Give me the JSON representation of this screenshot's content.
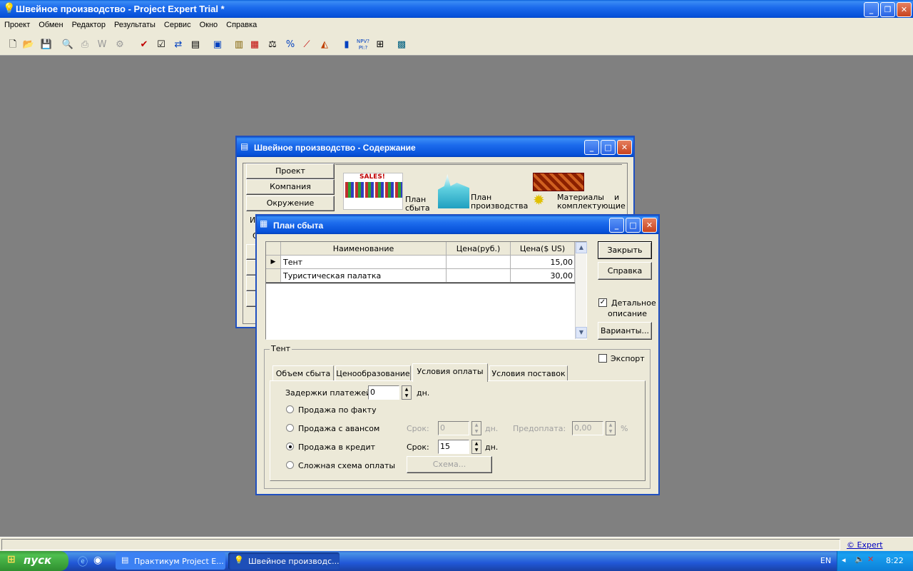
{
  "app": {
    "title": "Швейное производство - Project Expert Trial *",
    "menu": [
      "Проект",
      "Обмен",
      "Редактор",
      "Результаты",
      "Сервис",
      "Окно",
      "Справка"
    ]
  },
  "content_window": {
    "title": "Швейное производство - Содержание",
    "buttons": [
      "Проект",
      "Компания",
      "Окружение"
    ],
    "partial_labels": [
      "И",
      "О"
    ],
    "tiles": [
      {
        "icon": "sales-plan-icon",
        "label1": "План",
        "label2": "сбыта",
        "badge": "SALES!"
      },
      {
        "icon": "production-plan-icon",
        "label1": "План",
        "label2": "производства"
      },
      {
        "icon": "materials-icon",
        "label1": "Материалы    и",
        "label2": "комплектующие"
      }
    ]
  },
  "sales_dialog": {
    "title": "План сбыта",
    "columns": [
      "Наименование",
      "Цена(руб.)",
      "Цена($ US)"
    ],
    "rows": [
      {
        "name": "Тент",
        "price_rub": "",
        "price_usd": "15,00",
        "current": true
      },
      {
        "name": "Туристическая палатка",
        "price_rub": "",
        "price_usd": "30,00",
        "current": false
      }
    ],
    "close_label": "Закрыть",
    "help_label": "Справка",
    "detail_label_1": "Детальное",
    "detail_label_2": "описание",
    "detail_checked": true,
    "variants_label": "Варианты...",
    "group_label": "Тент",
    "export_label": "Экспорт",
    "export_checked": false,
    "tabs": [
      "Объем сбыта",
      "Ценообразование",
      "Условия оплаты",
      "Условия поставок"
    ],
    "active_tab": 2,
    "payment": {
      "delay_label": "Задержки платежей:",
      "delay_value": "0",
      "days": "дн.",
      "options": [
        "Продажа по факту",
        "Продажа с авансом",
        "Продажа в кредит",
        "Сложная схема оплаты"
      ],
      "selected": 2,
      "term_label": "Срок:",
      "advance_term_value": "0",
      "prepay_label": "Предоплата:",
      "prepay_value": "0,00",
      "percent": "%",
      "credit_term_value": "15",
      "scheme_label": "Схема..."
    }
  },
  "status": {
    "link": "© Expert Systems"
  },
  "taskbar": {
    "start": "пуск",
    "tasks": [
      "Практикум Project E...",
      "Швейное производс..."
    ],
    "lang": "EN",
    "time": "8:22"
  }
}
